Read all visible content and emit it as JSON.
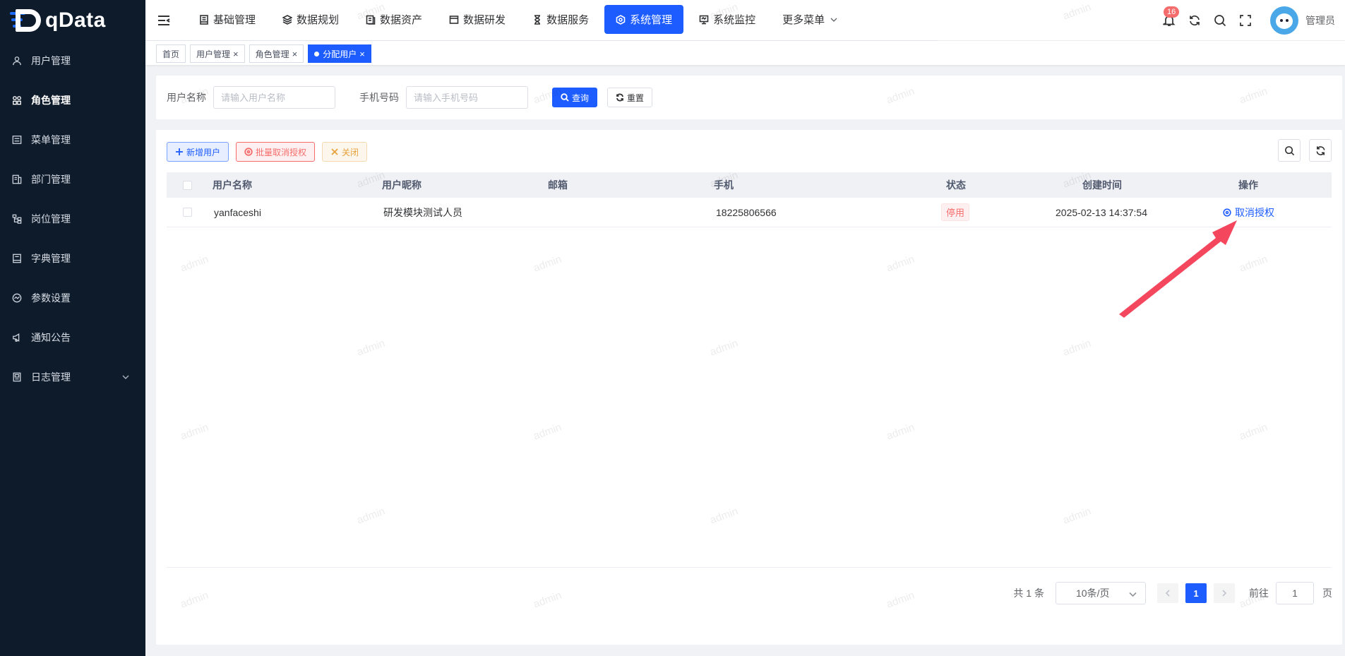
{
  "brand": {
    "logo_text": "qData"
  },
  "sidebar": {
    "items": [
      {
        "label": "用户管理",
        "icon": "user-icon"
      },
      {
        "label": "角色管理",
        "icon": "role-icon",
        "active": true
      },
      {
        "label": "菜单管理",
        "icon": "menu-icon"
      },
      {
        "label": "部门管理",
        "icon": "department-icon"
      },
      {
        "label": "岗位管理",
        "icon": "post-icon"
      },
      {
        "label": "字典管理",
        "icon": "dictionary-icon"
      },
      {
        "label": "参数设置",
        "icon": "settings-icon"
      },
      {
        "label": "通知公告",
        "icon": "megaphone-icon"
      },
      {
        "label": "日志管理",
        "icon": "log-icon",
        "expandable": true
      }
    ]
  },
  "topnav": {
    "items": [
      {
        "label": "基础管理",
        "icon": "base-icon"
      },
      {
        "label": "数据规划",
        "icon": "layers-icon"
      },
      {
        "label": "数据资产",
        "icon": "asset-icon"
      },
      {
        "label": "数据研发",
        "icon": "develop-icon"
      },
      {
        "label": "数据服务",
        "icon": "hourglass-icon"
      },
      {
        "label": "系统管理",
        "icon": "system-icon",
        "active": true
      },
      {
        "label": "系统监控",
        "icon": "monitor-icon"
      },
      {
        "label": "更多菜单",
        "icon": "",
        "dropdown": true
      }
    ]
  },
  "header": {
    "notification_count": "16",
    "username": "管理员"
  },
  "tags": [
    {
      "label": "首页",
      "closable": false
    },
    {
      "label": "用户管理",
      "closable": true
    },
    {
      "label": "角色管理",
      "closable": true
    },
    {
      "label": "分配用户",
      "closable": true,
      "active": true
    }
  ],
  "tag_close_glyph": "×",
  "search": {
    "username_label": "用户名称",
    "username_placeholder": "请输入用户名称",
    "phone_label": "手机号码",
    "phone_placeholder": "请输入手机号码",
    "query_label": "查询",
    "reset_label": "重置"
  },
  "toolbar": {
    "add_label": "新增用户",
    "batch_revoke_label": "批量取消授权",
    "close_label": "关闭"
  },
  "table": {
    "columns": [
      "用户名称",
      "用户昵称",
      "邮箱",
      "手机",
      "状态",
      "创建时间",
      "操作"
    ],
    "rows": [
      {
        "username": "yanfaceshi",
        "nickname": "研发模块测试人员",
        "email": "",
        "phone": "18225806566",
        "status": "停用",
        "created": "2025-02-13 14:37:54",
        "action": "取消授权"
      }
    ]
  },
  "pagination": {
    "total": "共 1 条",
    "page_size": "10条/页",
    "current_page": "1",
    "jump_label": "前往",
    "jump_value": "1",
    "page_unit": "页"
  },
  "watermark_text": "admin",
  "colors": {
    "primary": "#1d5cff",
    "sidebar_bg": "#0e1b2b",
    "danger": "#f56c6c",
    "warning": "#e6a23c",
    "annotation_arrow": "#f4475e"
  }
}
